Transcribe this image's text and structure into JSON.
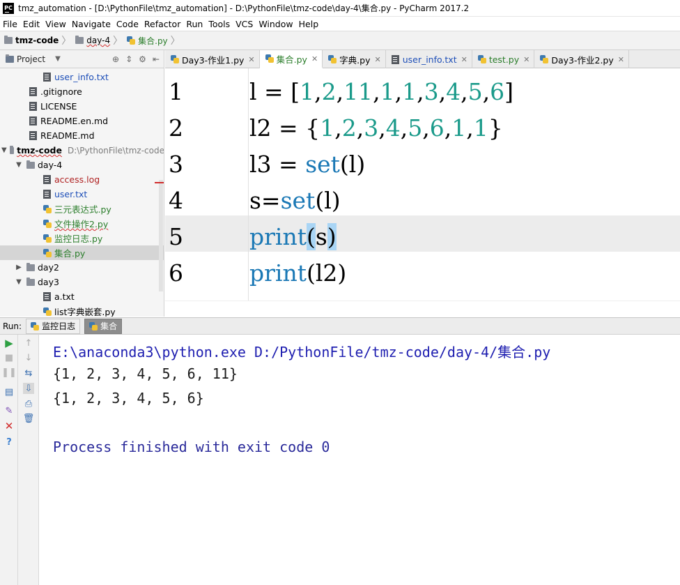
{
  "window": {
    "title": "tmz_automation - [D:\\PythonFile\\tmz_automation] - D:\\PythonFile\\tmz-code\\day-4\\集合.py - PyCharm 2017.2",
    "app_icon": "PC"
  },
  "menu": [
    "File",
    "Edit",
    "View",
    "Navigate",
    "Code",
    "Refactor",
    "Run",
    "Tools",
    "VCS",
    "Window",
    "Help"
  ],
  "breadcrumb": [
    "tmz-code",
    "day-4",
    "集合.py"
  ],
  "project_panel": {
    "title": "Project",
    "tree": [
      {
        "label": "user_info.txt",
        "type": "text",
        "color": "blue",
        "indent": 3
      },
      {
        "label": ".gitignore",
        "type": "text",
        "color": "default",
        "indent": 2
      },
      {
        "label": "LICENSE",
        "type": "text",
        "color": "default",
        "indent": 2
      },
      {
        "label": "README.en.md",
        "type": "text",
        "color": "default",
        "indent": 2
      },
      {
        "label": "README.md",
        "type": "text",
        "color": "default",
        "indent": 2
      },
      {
        "label": "tmz-code",
        "type": "folder",
        "color": "bold",
        "indent": 0,
        "arrow": "open",
        "path": "D:\\PythonFile\\tmz-code"
      },
      {
        "label": "day-4",
        "type": "folder",
        "color": "default",
        "indent": 1,
        "arrow": "open"
      },
      {
        "label": "access.log",
        "type": "text",
        "color": "red",
        "indent": 3
      },
      {
        "label": "user.txt",
        "type": "text",
        "color": "blue",
        "indent": 3
      },
      {
        "label": "三元表达式.py",
        "type": "python",
        "color": "green",
        "indent": 3
      },
      {
        "label": "文件操作2.py",
        "type": "python",
        "color": "green",
        "indent": 3
      },
      {
        "label": "监控日志.py",
        "type": "python",
        "color": "green",
        "indent": 3
      },
      {
        "label": "集合.py",
        "type": "python",
        "color": "green",
        "indent": 3,
        "selected": true
      },
      {
        "label": "day2",
        "type": "folder",
        "color": "default",
        "indent": 1,
        "arrow": "closed"
      },
      {
        "label": "day3",
        "type": "folder",
        "color": "default",
        "indent": 1,
        "arrow": "open"
      },
      {
        "label": "a.txt",
        "type": "text",
        "color": "default",
        "indent": 3
      },
      {
        "label": "list字典嵌套.py",
        "type": "python",
        "color": "default",
        "indent": 3
      }
    ]
  },
  "tabs": [
    {
      "label": "Day3-作业1.py",
      "type": "python",
      "color": "default"
    },
    {
      "label": "集合.py",
      "type": "python",
      "color": "green",
      "active": true
    },
    {
      "label": "字典.py",
      "type": "python",
      "color": "default"
    },
    {
      "label": "user_info.txt",
      "type": "text",
      "color": "blue"
    },
    {
      "label": "test.py",
      "type": "python",
      "color": "green"
    },
    {
      "label": "Day3-作业2.py",
      "type": "python",
      "color": "default"
    }
  ],
  "editor": {
    "lines": [
      {
        "n": "1",
        "code": "l = [1,2,11,1,1,3,4,5,6]"
      },
      {
        "n": "2",
        "code": "l2 = {1,2,3,4,5,6,1,1}"
      },
      {
        "n": "3",
        "code": "l3 = set(l)"
      },
      {
        "n": "4",
        "code": "s=set(l)"
      },
      {
        "n": "5",
        "code": "print(s)"
      },
      {
        "n": "6",
        "code": "print(l2)"
      }
    ]
  },
  "run": {
    "label": "Run:",
    "tabs": [
      "监控日志",
      "集合"
    ],
    "active_tab": "集合",
    "output": [
      "E:\\anaconda3\\python.exe D:/PythonFile/tmz-code/day-4/集合.py",
      "{1, 2, 3, 4, 5, 6, 11}",
      "{1, 2, 3, 4, 5, 6}",
      "",
      "Process finished with exit code 0"
    ]
  },
  "colors": {
    "number": "#1a9a8a",
    "keyword": "#1a78b5",
    "brace_highlight": "#a9d5f5",
    "console_text": "#1e1eb0"
  }
}
